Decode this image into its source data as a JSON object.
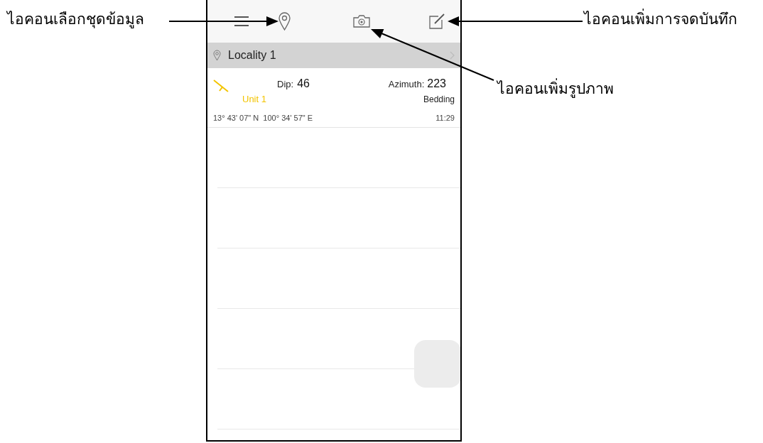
{
  "callouts": [
    {
      "text": "ไอคอนเลือกชุดข้อมูล"
    },
    {
      "text": "ไอคอนเพิ่มการจดบันทึก"
    },
    {
      "text": "ไอคอนเพิ่มรูปภาพ"
    }
  ],
  "locality": {
    "name": "Locality 1"
  },
  "records": [
    {
      "dip_label": "Dip:",
      "dip": "46",
      "azimuth_label": "Azimuth:",
      "azimuth": "223",
      "unit": "Unit 1",
      "type": "Bedding",
      "coords": "13° 43' 07\" N  100° 34' 57\" E",
      "time": "11:29"
    }
  ]
}
